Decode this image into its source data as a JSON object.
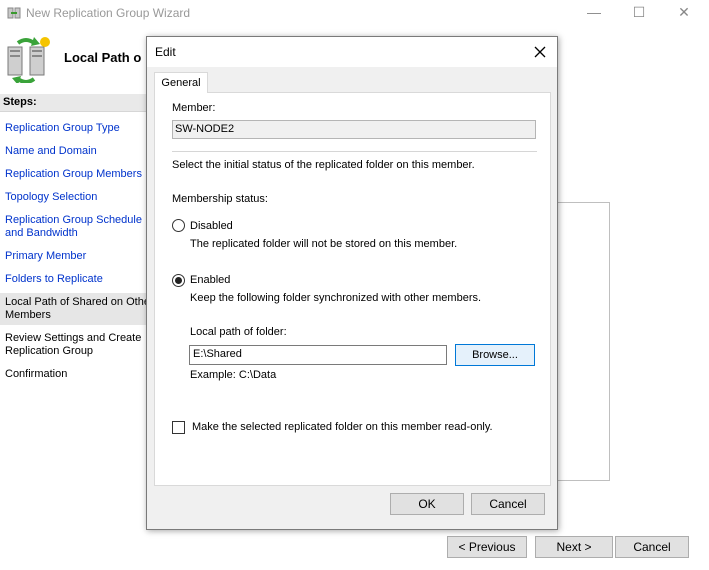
{
  "wizard": {
    "title": "New Replication Group Wizard",
    "heading": "Local Path o",
    "steps_title": "Steps:",
    "steps": [
      {
        "label": "Replication Group Type"
      },
      {
        "label": "Name and Domain"
      },
      {
        "label": "Replication Group Members"
      },
      {
        "label": "Topology Selection"
      },
      {
        "label_line1": "Replication Group Schedule",
        "label_line2": "and Bandwidth"
      },
      {
        "label": "Primary Member"
      },
      {
        "label": "Folders to Replicate"
      },
      {
        "label_line1": "Local Path of Shared on Othe",
        "label_line2": "Members"
      },
      {
        "label_line1": "Review Settings and Create",
        "label_line2": "Replication Group"
      },
      {
        "label": "Confirmation"
      }
    ],
    "buttons": {
      "previous": "< Previous",
      "next": "Next >",
      "cancel": "Cancel"
    }
  },
  "dialog": {
    "title": "Edit",
    "tab_general": "General",
    "member_label": "Member:",
    "member_value": "SW-NODE2",
    "instruction": "Select the initial status of the replicated folder on this member.",
    "membership_label": "Membership status:",
    "disabled": {
      "label": "Disabled",
      "description": "The replicated folder will not be stored on this member.",
      "selected": false
    },
    "enabled": {
      "label": "Enabled",
      "description": "Keep the following folder synchronized with other members.",
      "selected": true
    },
    "local_path_label": "Local path of folder:",
    "local_path_value": "E:\\Shared",
    "browse": "Browse...",
    "example": "Example: C:\\Data",
    "readonly_label": "Make the selected replicated folder on this member read-only.",
    "readonly_checked": false,
    "ok": "OK",
    "cancel": "Cancel"
  }
}
